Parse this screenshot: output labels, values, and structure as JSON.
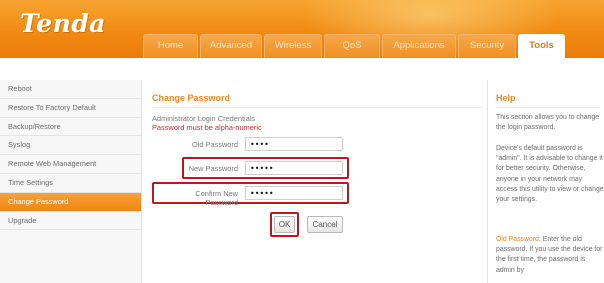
{
  "brand": {
    "logo": "Tenda"
  },
  "nav": {
    "tabs": [
      {
        "label": "Home"
      },
      {
        "label": "Advanced"
      },
      {
        "label": "Wireless"
      },
      {
        "label": "QoS"
      },
      {
        "label": "Applications"
      },
      {
        "label": "Security"
      },
      {
        "label": "Tools"
      }
    ],
    "active_tab": "Tools"
  },
  "sidebar": {
    "items": [
      {
        "label": "Reboot"
      },
      {
        "label": "Restore To Factory Default"
      },
      {
        "label": "Backup/Restore"
      },
      {
        "label": "Syslog"
      },
      {
        "label": "Remote Web Management"
      },
      {
        "label": "Time Settings"
      },
      {
        "label": "Change Password"
      },
      {
        "label": "Upgrade"
      }
    ],
    "active_item": "Change Password"
  },
  "main": {
    "title": "Change Password",
    "subtitle": "Administrator Login Credentials",
    "warning": "Password must be alpha-numeric",
    "fields": {
      "old": {
        "label": "Old Password",
        "value": "••••"
      },
      "new": {
        "label": "New Password",
        "value": "•••••"
      },
      "confirm": {
        "label": "Confirm New Password",
        "value": "•••••"
      }
    },
    "ok_label": "OK",
    "cancel_label": "Cancel"
  },
  "help": {
    "title": "Help",
    "para1": "This section allows you to change the login password.",
    "para2": "Device's default password is \"admin\". It is advisable to change it for better security. Otherwise, anyone in your network may access this utility to view or change your settings.",
    "para3_kw": "Old Password",
    "para3_rest": ": Enter the old password. If you use the device for the first time, the password is admin by"
  },
  "colors": {
    "accent": "#f0861c",
    "header_orange": "#f18a12",
    "highlight_red": "#b71c1c",
    "warning_red": "#e0242c"
  }
}
